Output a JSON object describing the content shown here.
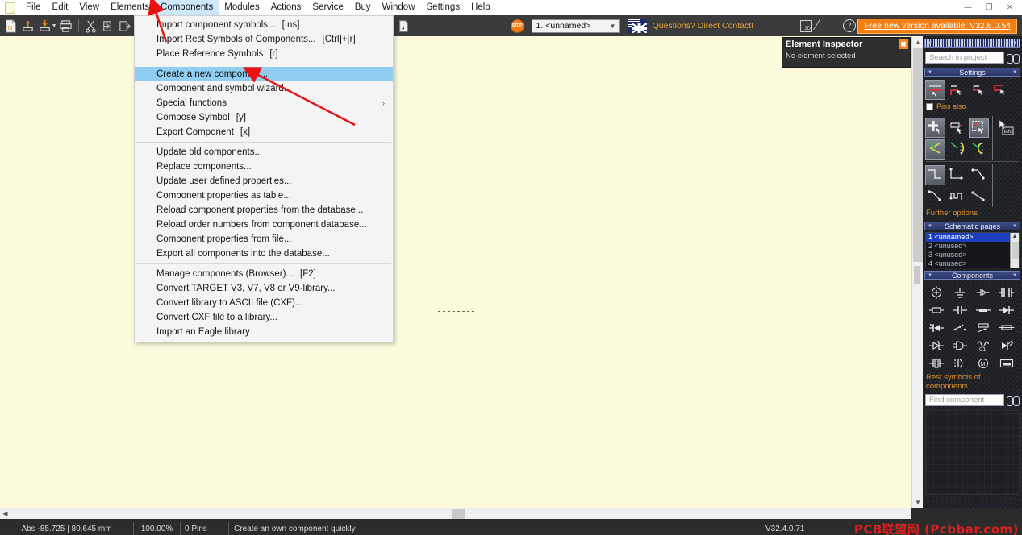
{
  "window": {
    "minimize_label": "—",
    "restore_label": "❐",
    "close_label": "✕"
  },
  "menubar": {
    "items": [
      {
        "label": "File",
        "open": false
      },
      {
        "label": "Edit",
        "open": false
      },
      {
        "label": "View",
        "open": false
      },
      {
        "label": "Elements",
        "open": false
      },
      {
        "label": "Components",
        "open": true
      },
      {
        "label": "Modules",
        "open": false
      },
      {
        "label": "Actions",
        "open": false
      },
      {
        "label": "Service",
        "open": false
      },
      {
        "label": "Buy",
        "open": false
      },
      {
        "label": "Window",
        "open": false
      },
      {
        "label": "Settings",
        "open": false
      },
      {
        "label": "Help",
        "open": false
      }
    ]
  },
  "dropdown": {
    "owner": "Components",
    "groups": [
      [
        {
          "label": "Import component symbols...",
          "key": "[Ins]",
          "highlighted": false,
          "submenu": false
        },
        {
          "label": "Import Rest Symbols of Components...",
          "key": "[Ctrl]+[r]",
          "highlighted": false,
          "submenu": false
        },
        {
          "label": "Place Reference Symbols",
          "key": "[r]",
          "highlighted": false,
          "submenu": false
        }
      ],
      [
        {
          "label": "Create a new component...",
          "key": "",
          "highlighted": true,
          "submenu": false
        },
        {
          "label": "Component and symbol wizard...",
          "key": "",
          "highlighted": false,
          "submenu": false
        },
        {
          "label": "Special functions",
          "key": "",
          "highlighted": false,
          "submenu": true
        },
        {
          "label": "Compose Symbol",
          "key": "[y]",
          "highlighted": false,
          "submenu": false
        },
        {
          "label": "Export Component",
          "key": "[x]",
          "highlighted": false,
          "submenu": false
        }
      ],
      [
        {
          "label": "Update old components...",
          "key": "",
          "highlighted": false,
          "submenu": false
        },
        {
          "label": "Replace components...",
          "key": "",
          "highlighted": false,
          "submenu": false
        },
        {
          "label": "Update user defined properties...",
          "key": "",
          "highlighted": false,
          "submenu": false
        },
        {
          "label": "Component properties as table...",
          "key": "",
          "highlighted": false,
          "submenu": false
        },
        {
          "label": "Reload component properties from the database...",
          "key": "",
          "highlighted": false,
          "submenu": false
        },
        {
          "label": "Reload order numbers from component database...",
          "key": "",
          "highlighted": false,
          "submenu": false
        },
        {
          "label": "Component properties from file...",
          "key": "",
          "highlighted": false,
          "submenu": false
        },
        {
          "label": "Export all components into the database...",
          "key": "",
          "highlighted": false,
          "submenu": false
        }
      ],
      [
        {
          "label": "Manage components (Browser)...",
          "key": "[F2]",
          "highlighted": false,
          "submenu": false
        },
        {
          "label": "Convert TARGET V3, V7, V8 or V9-library...",
          "key": "",
          "highlighted": false,
          "submenu": false
        },
        {
          "label": "Convert library to ASCII file (CXF)...",
          "key": "",
          "highlighted": false,
          "submenu": false
        },
        {
          "label": "Convert CXF file to a library...",
          "key": "",
          "highlighted": false,
          "submenu": false
        },
        {
          "label": "Import an Eagle library",
          "key": "",
          "highlighted": false,
          "submenu": false
        }
      ]
    ]
  },
  "toolbar": {
    "page_selector_value": "1. <unnamed>",
    "contact_text": "Questions? Direct Contact!",
    "new_version_badge": "Free new version available: V32.6.0.54",
    "stop_label": "STOP",
    "help_label": "?",
    "icons": [
      "new-document-icon",
      "open-project-icon",
      "save-project-icon",
      "print-icon",
      "cut-icon",
      "copy-icon",
      "paste-icon",
      "eraser-icon",
      "magic-wand-icon",
      "page-2-icon",
      "page-3-icon",
      "page-4-icon",
      "stop-icon",
      "language-flag-icon",
      "3d-view-icon",
      "help-icon"
    ]
  },
  "inspector": {
    "title": "Element Inspector",
    "empty_text": "No element selected",
    "close_label": "✖"
  },
  "right_panel": {
    "search": {
      "placeholder": "Search in project",
      "value": ""
    },
    "sections": [
      {
        "id": "settings",
        "title": "Settings"
      },
      {
        "id": "schematic-pages",
        "title": "Schematic pages"
      },
      {
        "id": "components",
        "title": "Components"
      }
    ],
    "settings": {
      "pins_also_label": "Pins also",
      "pins_also_checked": false,
      "further_options_label": "Further options",
      "info_label": "Info",
      "tools_row1": [
        "pin-left-tool",
        "pin-top-tool",
        "pin-right-tool",
        "pin-bottom-tool"
      ],
      "tools_row2": [
        "add-element-tool",
        "move-element-tool",
        "select-area-tool"
      ],
      "tools_row3": [
        "angle-sharp-tool",
        "angle-arc-tool",
        "angle-curve-tool"
      ],
      "tools_row4": [
        "route-corner-tool",
        "route-step-tool",
        "route-diagonal-tool",
        "route-slope-tool",
        "route-zigzag-tool",
        "route-line-tool"
      ]
    },
    "schematic_pages": {
      "items": [
        {
          "label": "1 <unnamed>",
          "selected": true
        },
        {
          "label": "2 <unused>",
          "selected": false
        },
        {
          "label": "3 <unused>",
          "selected": false
        },
        {
          "label": "4 <unused>",
          "selected": false
        }
      ]
    },
    "components": {
      "rest_symbols_label": "Rest symbols of components",
      "find_placeholder": "Find component",
      "find_value": "",
      "symbols": [
        "current-source-symbol",
        "ground-symbol",
        "connector-symbol",
        "transformer-symbol",
        "resistor-symbol",
        "capacitor-symbol",
        "inductor-symbol",
        "diode-symbol",
        "thyristor-symbol",
        "switch-symbol",
        "potentiometer-symbol",
        "fuse-symbol",
        "zener-diode-symbol",
        "logic-gate-symbol",
        "oscillator-symbol",
        "led-symbol",
        "crystal-symbol",
        "relay-symbol",
        "motor-symbol",
        "display-symbol"
      ]
    }
  },
  "canvas": {
    "cursor_marker": "crosshair-cursor"
  },
  "statusbar": {
    "coordinates": "Abs -85.725 | 80.645 mm",
    "zoom": "100.00%",
    "pins": "0 Pins",
    "hint": "Create an own component quickly",
    "version": "V32.4.0.71"
  },
  "watermark": {
    "text": "PCB联盟网 (Pcbbar.com)",
    "color": "#e21f1f"
  },
  "colors": {
    "canvas_bg": "#fbfbdc",
    "toolbar_bg": "#3b3b3b",
    "panel_bg": "#23252b",
    "accent_orange": "#f07e12",
    "menu_highlight": "#8fcdf2",
    "selection_blue": "#1b3fbf"
  }
}
